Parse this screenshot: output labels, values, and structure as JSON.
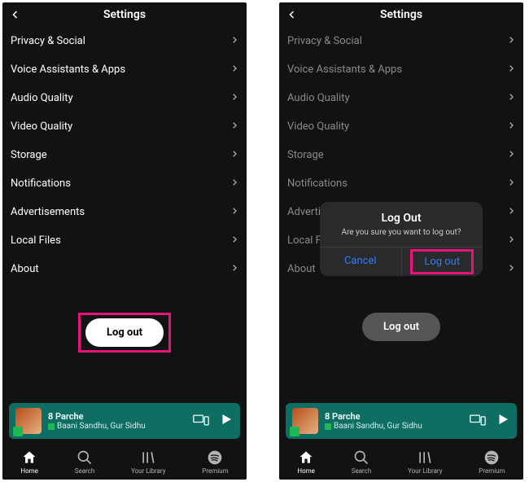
{
  "header": {
    "title": "Settings"
  },
  "settings_items": [
    "Privacy & Social",
    "Voice Assistants & Apps",
    "Audio Quality",
    "Video Quality",
    "Storage",
    "Notifications",
    "Advertisements",
    "Local Files",
    "About"
  ],
  "logout_label": "Log out",
  "dialog": {
    "title": "Log Out",
    "message": "Are you sure you want to log out?",
    "cancel": "Cancel",
    "confirm": "Log out"
  },
  "now_playing": {
    "title": "8 Parche",
    "artist": "Baani Sandhu, Gur Sidhu"
  },
  "nav": {
    "home": "Home",
    "search": "Search",
    "library": "Your Library",
    "premium": "Premium"
  }
}
